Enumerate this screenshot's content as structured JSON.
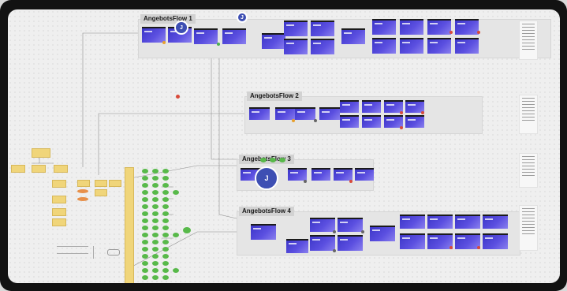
{
  "flows": [
    {
      "id": "flow1",
      "title": "AngebotsFlow 1"
    },
    {
      "id": "flow2",
      "title": "AngebotsFlow 2"
    },
    {
      "id": "flow3",
      "title": "AngebotsFlow 3"
    },
    {
      "id": "flow4",
      "title": "AngebotsFlow 4"
    }
  ],
  "avatars": [
    {
      "id": "avatar-1",
      "initial": "J"
    },
    {
      "id": "avatar-2",
      "initial": "J"
    },
    {
      "id": "avatar-3",
      "initial": "J"
    }
  ],
  "colors": {
    "canvas": "#efefef",
    "frame": "#121212",
    "screen_gradient_start": "#3c36c8",
    "screen_gradient_end": "#8a80ee",
    "sticky": "#f0d57a",
    "decision_node": "#e8904a",
    "state_node": "#58b94a",
    "avatar": "#3e4fb3",
    "status_red": "#d94a3a",
    "status_green": "#4cb050"
  }
}
